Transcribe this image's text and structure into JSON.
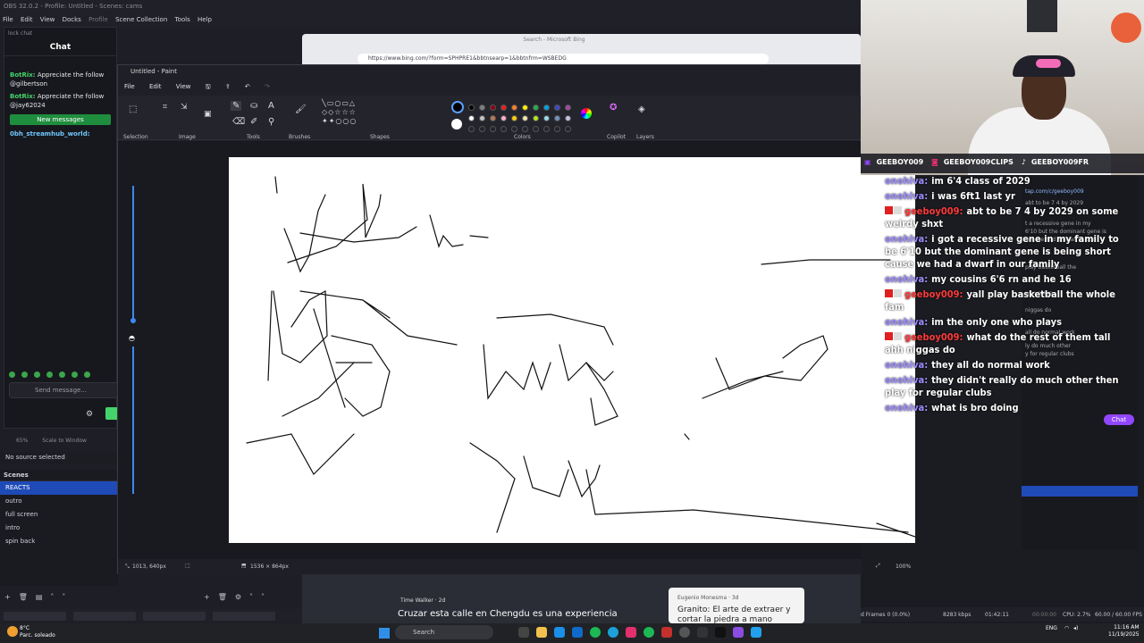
{
  "obs": {
    "title": "OBS 32.0.2 - Profile: Untitled - Scenes: cams",
    "menu": [
      "File",
      "Edit",
      "View",
      "Docks",
      "Profile",
      "Scene Collection",
      "Tools",
      "Help"
    ],
    "chat_dock_label": "lock chat",
    "chat_title": "Chat",
    "messages": [
      {
        "user": "BotRix:",
        "text": "Appreciate the follow @gilbertson"
      },
      {
        "user": "BotRix:",
        "text": "Appreciate the follow @jay62024"
      }
    ],
    "new_messages": "New messages",
    "last_msg_user": "0bh_streamhub_world:",
    "send_placeholder": "Send message...",
    "zoom": "65%",
    "scale": "Scale to Window",
    "no_source": "No source selected",
    "scenes_title": "Scenes",
    "scenes": [
      "REACTS",
      "outro",
      "full screen",
      "intro",
      "spin back"
    ]
  },
  "edge": {
    "search": "Search - Microsoft Bing",
    "url": "https://www.bing.com/?form=SPHPRE1&bbtnsearp=1&bbtnfrm=WSBEDG"
  },
  "paint": {
    "title": "Untitled - Paint",
    "menu": [
      "File",
      "Edit",
      "View"
    ],
    "groups": [
      "Selection",
      "Image",
      "Tools",
      "Brushes",
      "Shapes",
      "Colors",
      "Copilot",
      "Layers"
    ],
    "cursor_pos": "1013, 640px",
    "canvas_size": "1536 × 864px",
    "zoom": "100%"
  },
  "colors": {
    "swatches_row1": [
      "#000000",
      "#7f7f7f",
      "#880015",
      "#ed1c24",
      "#ff7f27",
      "#fff200",
      "#22b14c",
      "#00a2e8",
      "#3f48cc",
      "#a349a4"
    ],
    "swatches_row2": [
      "#ffffff",
      "#c3c3c3",
      "#b97a57",
      "#ffaec9",
      "#ffc90e",
      "#efe4b0",
      "#b5e61d",
      "#99d9ea",
      "#7092be",
      "#c8bfe7"
    ]
  },
  "webcam": {
    "socials": [
      "GEEBOY009",
      "GEEBOY009CLIPS",
      "GEEBOY009FR"
    ]
  },
  "stream_chat": [
    {
      "user": "onohiva:",
      "text": "im 6'4 class of 2029",
      "red": false
    },
    {
      "user": "onohiva:",
      "text": "i was 6ft1 last yr",
      "red": false
    },
    {
      "user": "geeboy009:",
      "text": "abt to be 7 4 by 2029 on some weirdy shxt",
      "red": true
    },
    {
      "user": "onohiva:",
      "text": "i got a recessive gene in my family to be 6'10 but the dominant gene is being short cause we had a dwarf in our family",
      "red": false
    },
    {
      "user": "onohiva:",
      "text": "my cousins 6'6 rn and he 16",
      "red": false
    },
    {
      "user": "geeboy009:",
      "text": "yall play basketball the whole fam",
      "red": true
    },
    {
      "user": "onohiva:",
      "text": "im the only one who plays",
      "red": false
    },
    {
      "user": "geeboy009:",
      "text": "what do the rest of them tall ahh niggas do",
      "red": true
    },
    {
      "user": "onohiva:",
      "text": "they all do normal work",
      "red": false
    },
    {
      "user": "onohiva:",
      "text": "they didn't really do much other then play for regular clubs",
      "red": false
    },
    {
      "user": "onohiva:",
      "text": "what is bro doing",
      "red": false
    }
  ],
  "twitch_behind": [
    "tap.com/c/geeboy009",
    "abt to be 7 4 by 2029",
    "t a recessive gene in my",
    "6'10 but the dominant gene is",
    "use we had a dwarf in our",
    "play basketball the",
    "who plays",
    "niggas do",
    "all do normal work",
    "ly do much other",
    "y for regular clubs",
    "Chat"
  ],
  "obs_status": {
    "frames": "d Frames 0 (0.0%)",
    "bitrate": "8283 kbps",
    "time": "01:42:11",
    "rec": "00:00:00",
    "cpu": "CPU: 2.7%",
    "fps": "60.00 / 60.00 FPS"
  },
  "news": {
    "src1": "Time Walker · 2d",
    "title1": "Cruzar esta calle en Chengdu es una experiencia",
    "src2": "Eugenio Monesma · 3d",
    "title2": "Granito: El arte de extraer y cortar la piedra a mano"
  },
  "taskbar": {
    "weather_temp": "8°C",
    "weather_desc": "Parc. soleado",
    "search": "Search",
    "lang": "ENG",
    "time": "11:16 AM",
    "date": "11/19/2025"
  }
}
